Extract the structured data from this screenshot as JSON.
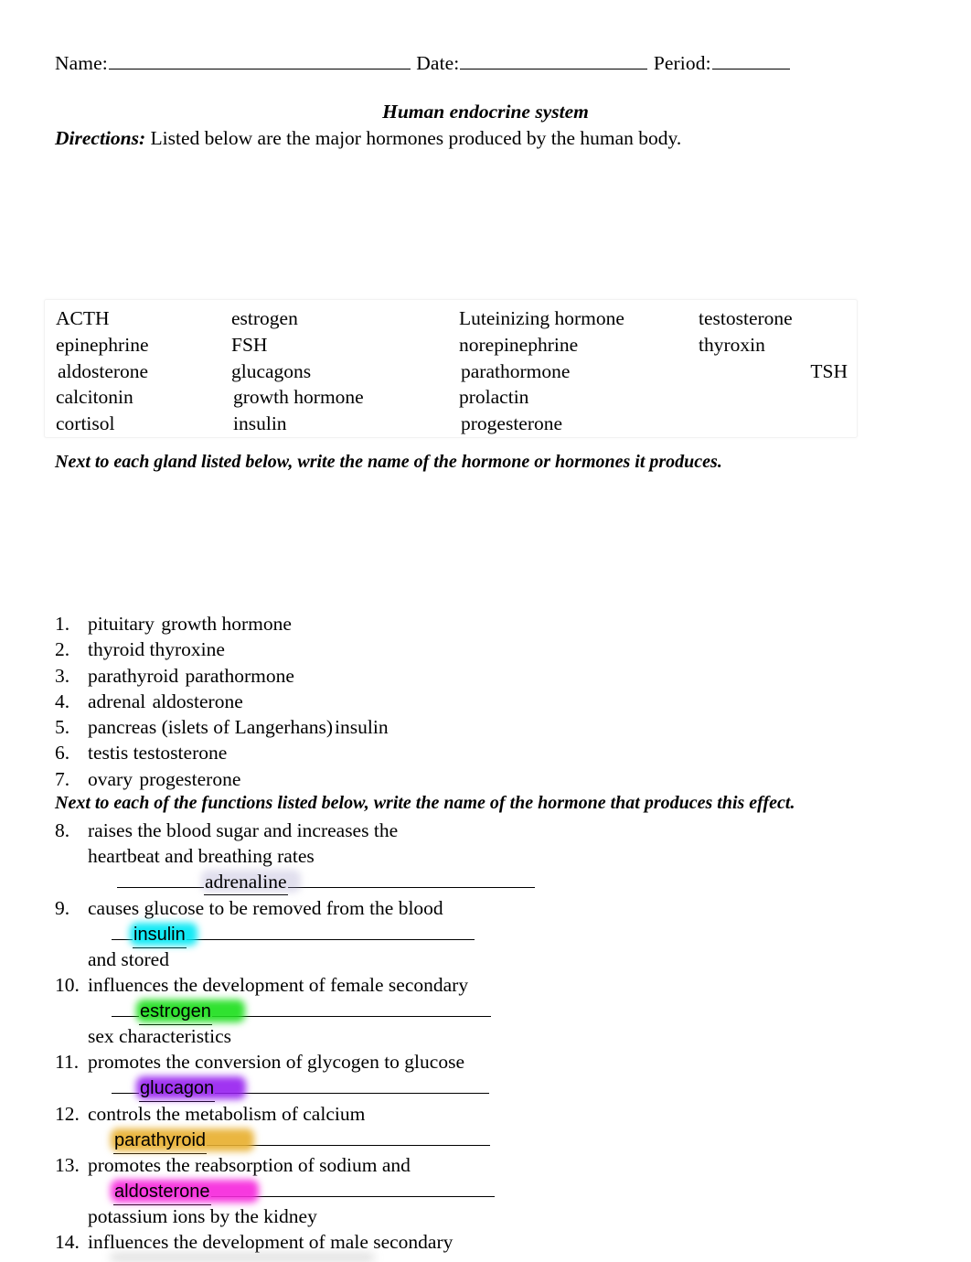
{
  "header": {
    "name_label": "Name:",
    "date_label": "Date:",
    "period_label": "Period:"
  },
  "title": "Human endocrine system",
  "directions": {
    "label": "Directions:",
    "text": " Listed below are the major hormones produced by the human body."
  },
  "subdirections": {
    "glands": "Next to each gland listed below, write the name of the hormone or hormones it produces.",
    "functions": "Next to each of the functions listed below, write the name of the hormone that produces this effect."
  },
  "word_bank": {
    "column1": [
      "ACTH",
      "epinephrine",
      "aldosterone",
      "calcitonin",
      "cortisol"
    ],
    "column2": [
      "estrogen",
      "FSH",
      "glucagons",
      "growth hormone",
      "insulin"
    ],
    "column3": [
      "Luteinizing hormone",
      "norepinephrine",
      "parathormone",
      "prolactin",
      "progesterone"
    ],
    "column4": [
      "testosterone",
      "thyroxin",
      "TSH"
    ]
  },
  "gland_items": [
    {
      "num": "1.",
      "gland": "pituitary ",
      "answer": "growth hormone"
    },
    {
      "num": "2.",
      "gland": "thyroid ",
      "answer": "thyroxine"
    },
    {
      "num": "3.",
      "gland": "parathyroid ",
      "answer": "parathormone"
    },
    {
      "num": "4.",
      "gland": "adrenal ",
      "answer": "aldosterone"
    },
    {
      "num": "5.",
      "gland": "pancreas (islets of Langerhans)",
      "answer": "insulin"
    },
    {
      "num": "6.",
      "gland": "testis ",
      "answer": "testosterone"
    },
    {
      "num": "7.",
      "gland": "ovary ",
      "answer": "progesterone"
    }
  ],
  "function_items": [
    {
      "num": "8.",
      "line1": "raises the blood sugar and increases the",
      "line2": "heartbeat and breathing rates",
      "lead_underscores": "_________",
      "answer": "adrenaline",
      "trail_underscores": "______________________",
      "line3": ""
    },
    {
      "num": "9.",
      "line1": "causes glucose to be removed from the blood",
      "line2": "",
      "lead_underscores": "___",
      "answer": "insulin",
      "trail_underscores": "___________________________",
      "line3": "and stored"
    },
    {
      "num": "10.",
      "line1": "influences the development of female secondary",
      "line2": "",
      "lead_underscores": "____",
      "answer": "estrogen",
      "trail_underscores": "_______________________",
      "line3": "sex characteristics"
    },
    {
      "num": "11.",
      "line1": "promotes the conversion of glycogen to glucose",
      "line2": "",
      "lead_underscores": "____",
      "answer": "glucagon",
      "trail_underscores": "_______________________",
      "line3": ""
    },
    {
      "num": "12.",
      "line1": "controls the metabolism of calcium",
      "line2": "",
      "lead_underscores": "",
      "answer": "parathyroid",
      "trail_underscores": "________________________",
      "line3": ""
    },
    {
      "num": "13.",
      "line1": "promotes the reabsorption of sodium and",
      "line2": "",
      "lead_underscores": "",
      "answer": "aldosterone",
      "trail_underscores": "_______________________",
      "line3": "potassium ions by the kidney"
    },
    {
      "num": "14.",
      "line1": "influences the development of male secondary",
      "line2": "",
      "lead_underscores": "",
      "answer": "",
      "trail_underscores": "",
      "line3": ""
    }
  ],
  "highlight_colors": {
    "rose": "#d2829b",
    "salmon": "#e28470",
    "gold": "#f6c43e",
    "periwinkle": "#96aae1",
    "cyan": "#00e7f3",
    "green": "#1ee01e",
    "purple": "#961ef0",
    "magenta": "#f628dc",
    "lavender": "#a8a0cd"
  }
}
